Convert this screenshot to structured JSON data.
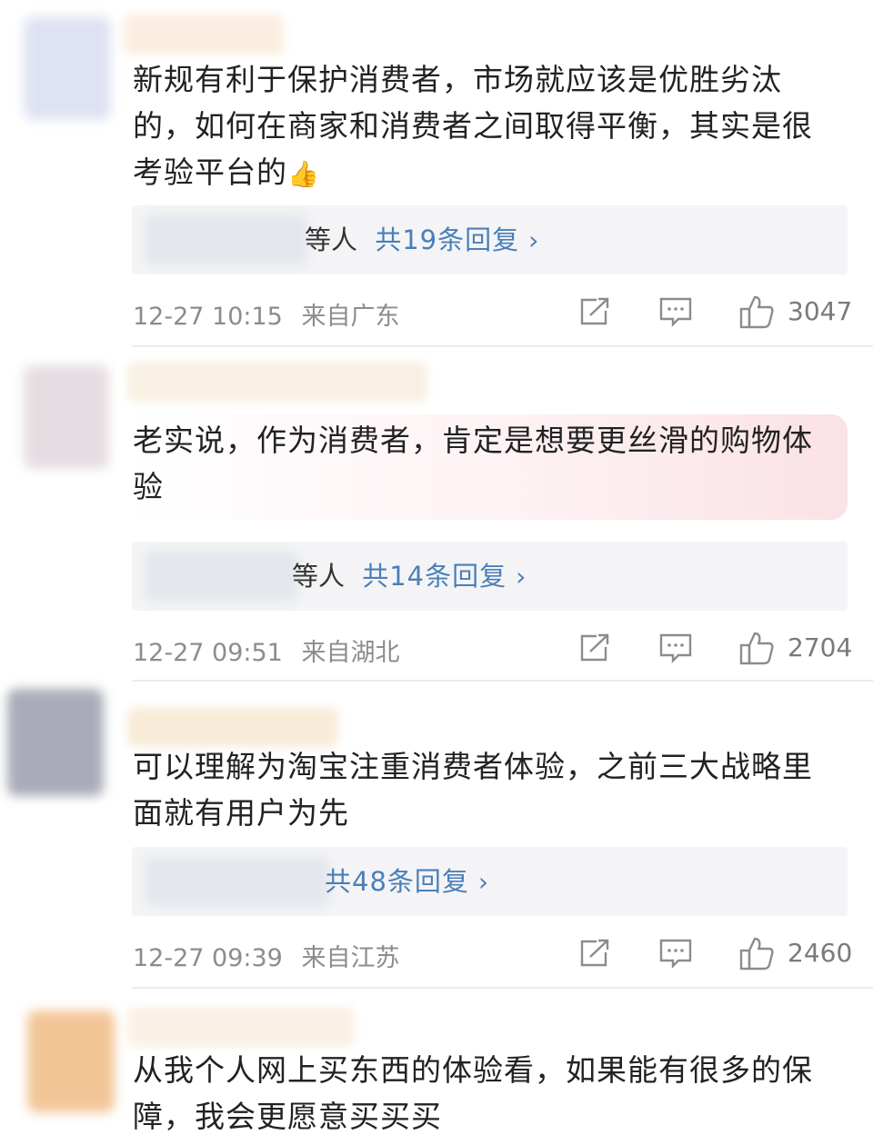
{
  "comments": [
    {
      "text": "新规有利于保护消费者，市场就应该是优胜劣汰的，如何在商家和消费者之间取得平衡，其实是很考验平台的",
      "emoji": "👍",
      "reply_who_fragment": "等人",
      "reply_count_label": "共19条回复",
      "timestamp": "12-27 10:15",
      "location": "来自广东",
      "likes": "3047"
    },
    {
      "text": "老实说，作为消费者，肯定是想要更丝滑的购物体验",
      "reply_who_fragment": "等人",
      "reply_count_label": "共14条回复",
      "timestamp": "12-27 09:51",
      "location": "来自湖北",
      "likes": "2704"
    },
    {
      "text": "可以理解为淘宝注重消费者体验，之前三大战略里面就有用户为先",
      "reply_count_label": "共48条回复",
      "timestamp": "12-27 09:39",
      "location": "来自江苏",
      "likes": "2460"
    },
    {
      "text": "从我个人网上买东西的体验看，如果能有很多的保障，我会更愿意买买买"
    }
  ],
  "icons": {
    "share": "share-icon",
    "comment": "comment-icon",
    "like": "thumbs-up-icon",
    "chevron": "chevron-right-icon"
  },
  "colors": {
    "link_blue": "#4a7fb8",
    "meta_gray": "#8c8c8c",
    "reply_bg": "#f4f4f6"
  }
}
